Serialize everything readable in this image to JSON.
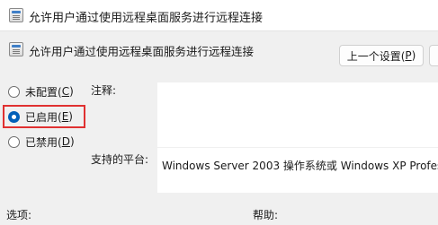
{
  "window": {
    "title": "允许用户通过使用远程桌面服务进行远程连接"
  },
  "header": {
    "policy_title": "允许用户通过使用远程桌面服务进行远程连接",
    "prev_button": {
      "text": "上一个设置(",
      "key": "P",
      "suffix": ")"
    }
  },
  "state": {
    "options": [
      {
        "text": "未配置(",
        "key": "C",
        "suffix": ")",
        "selected": false
      },
      {
        "text": "已启用(",
        "key": "E",
        "suffix": ")",
        "selected": true
      },
      {
        "text": "已禁用(",
        "key": "D",
        "suffix": ")",
        "selected": false
      }
    ]
  },
  "fields": {
    "comment_label": "注释:",
    "platform_label": "支持的平台:",
    "platform_value": "Windows Server 2003 操作系统或 Windows XP Profes"
  },
  "footer": {
    "options_label": "选项:",
    "help_label": "帮助:"
  },
  "colors": {
    "accent": "#005fb8",
    "highlight": "#e03131"
  }
}
